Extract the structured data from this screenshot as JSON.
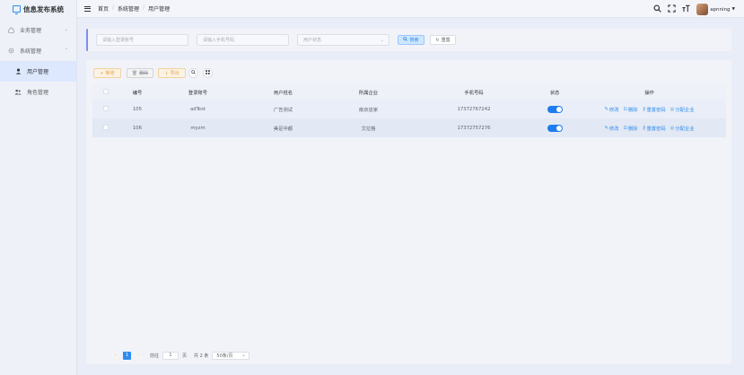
{
  "app": {
    "title": "信息发布系统",
    "accent": "#2d8cf0"
  },
  "sidebar": {
    "items": [
      {
        "label": "业务管理",
        "icon": "home-icon"
      },
      {
        "label": "系统管理",
        "icon": "gear-icon"
      },
      {
        "label": "用户管理",
        "icon": "user-icon",
        "active": true
      },
      {
        "label": "角色管理",
        "icon": "users-icon"
      }
    ]
  },
  "header": {
    "breadcrumbs": [
      "首页",
      "系统管理",
      "用户管理"
    ],
    "username": "apnning"
  },
  "search": {
    "account_placeholder": "请输入登录账号",
    "phone_placeholder": "请输入手机号码",
    "status_placeholder": "用户状态",
    "search_label": "搜索",
    "reset_label": "重置"
  },
  "toolbar": {
    "add_label": "新增",
    "delete_label": "删除",
    "export_label": "导出"
  },
  "table": {
    "columns": [
      "编号",
      "登录账号",
      "用户姓名",
      "所属企业",
      "手机号码",
      "状态",
      "操作"
    ],
    "rows": [
      {
        "id": "105",
        "account": "adTest",
        "name": "广告测试",
        "company": "南京店家",
        "phone": "17372767242",
        "enabled": true
      },
      {
        "id": "106",
        "account": "myzm",
        "name": "美足中都",
        "company": "艾拉格",
        "phone": "17372757276",
        "enabled": true
      }
    ],
    "ops": {
      "edit": "修改",
      "delete": "删除",
      "reset_pw": "重置密码",
      "assign": "分配企业"
    }
  },
  "pagination": {
    "current": "1",
    "goto_label": "前往",
    "page_input": "1",
    "page_unit": "页",
    "total": "共 2 条",
    "page_size": "50条/页"
  }
}
